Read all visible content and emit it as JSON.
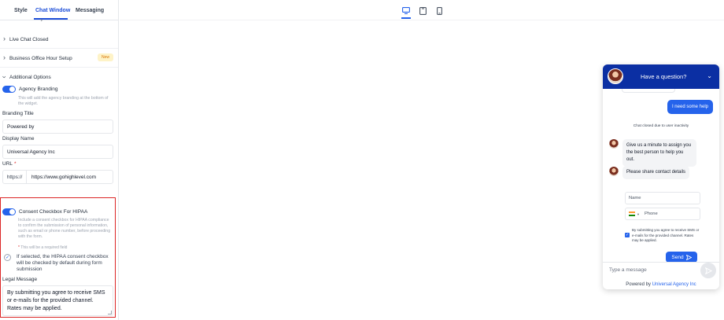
{
  "tabs": [
    {
      "label": "Style",
      "active": false
    },
    {
      "label": "Chat Window",
      "active": true
    },
    {
      "label": "Messaging",
      "active": false
    }
  ],
  "sections": {
    "live_chat_closed": "Live Chat Closed",
    "business_hours": "Business Office Hour Setup",
    "business_hours_badge": "New",
    "additional_options": "Additional Options"
  },
  "agency_branding": {
    "label": "Agency Branding",
    "enabled": true,
    "help": "This will add the agency branding at the bottom of the widget."
  },
  "branding_title": {
    "label": "Branding Title",
    "value": "Powered by"
  },
  "display_name": {
    "label": "Display Name",
    "value": "Universal Agency Inc"
  },
  "url": {
    "label": "URL",
    "required_mark": "*",
    "prefix": "https://",
    "value": "https://www.gohighlevel.com"
  },
  "hipaa": {
    "label": "Consent Checkbox For HIPAA",
    "enabled": true,
    "help": "Include a consent checkbox for HIPAA compliance to confirm the submission of personal information, such as email or phone number, before proceeding with the form.",
    "required_note": "This will be a required field",
    "required_star": "*",
    "default_checked_label": "If selected, the HIPAA consent checkbox will be checked by default during form submission",
    "default_checked": true,
    "legal_label": "Legal Message",
    "legal_message": "By submitting you agree to receive SMS or e-mails for the provided channel. Rates may be applied."
  },
  "devices": [
    {
      "name": "desktop",
      "active": true
    },
    {
      "name": "tablet",
      "active": false
    },
    {
      "name": "mobile",
      "active": false
    }
  ],
  "chat": {
    "header_title": "Have a question?",
    "user_message": "I need some help",
    "system_note": "Chat closed due to user inactivity",
    "agent_message_1": "Give us a minute to assign you the best person to help you out.",
    "agent_message_2": "Please share contact details",
    "name_placeholder": "Name",
    "phone_placeholder": "Phone",
    "consent_text": "By submitting you agree to receive SMS or e-mails for the provided channel. Rates may be applied.",
    "send_label": "Send",
    "composer_placeholder": "Type a message",
    "powered_by": "Powered by",
    "powered_brand": "Universal Agency Inc"
  },
  "colors": {
    "primary": "#2563eb",
    "header": "#0b2fa3",
    "highlight": "#dc2626",
    "badge_text": "#d97706",
    "badge_bg": "#fef3c7"
  },
  "icons": [
    "chevron-right-icon",
    "chevron-down-icon",
    "desktop-icon",
    "tablet-icon",
    "mobile-icon",
    "collapse-chevron-icon",
    "send-arrow-icon",
    "check-icon"
  ]
}
